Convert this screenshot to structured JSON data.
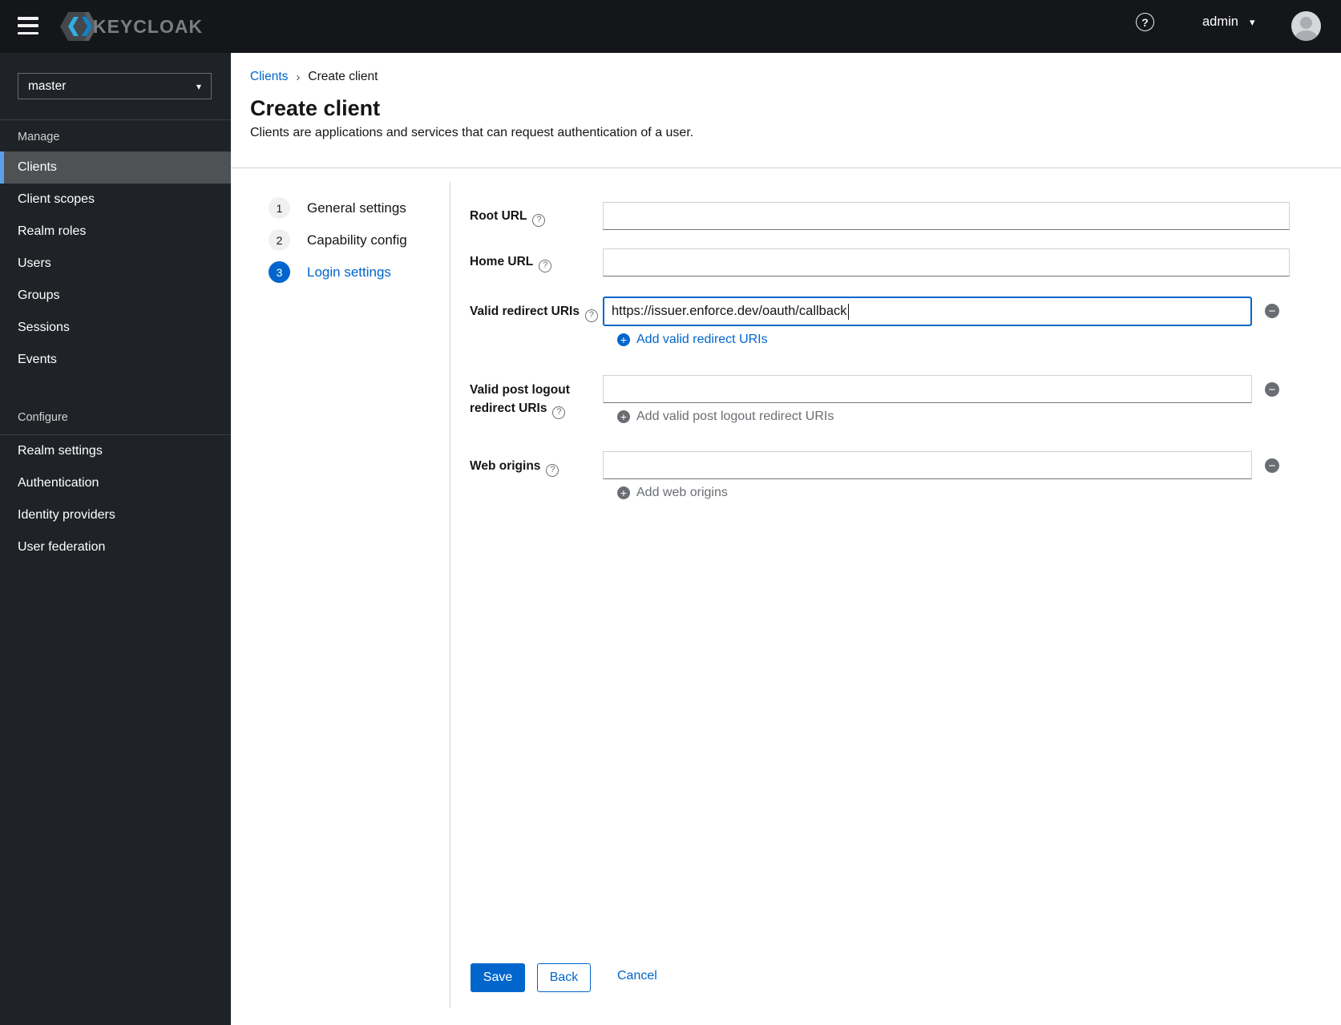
{
  "topbar": {
    "brand": "KEYCLOAK",
    "username": "admin"
  },
  "sidebar": {
    "realm_selector": {
      "value": "master"
    },
    "sections": [
      {
        "title": "Manage",
        "items": [
          "Clients",
          "Client scopes",
          "Realm roles",
          "Users",
          "Groups",
          "Sessions",
          "Events"
        ]
      },
      {
        "title": "Configure",
        "items": [
          "Realm settings",
          "Authentication",
          "Identity providers",
          "User federation"
        ]
      }
    ],
    "selected_item": "Clients"
  },
  "breadcrumb": {
    "link": "Clients",
    "current": "Create client"
  },
  "page": {
    "title": "Create client",
    "subtitle": "Clients are applications and services that can request authentication of a user."
  },
  "wizard": {
    "active_step": "3",
    "steps": [
      {
        "number": "1",
        "label": "General settings"
      },
      {
        "number": "2",
        "label": "Capability config"
      },
      {
        "number": "3",
        "label": "Login settings"
      }
    ]
  },
  "form": {
    "root_url": {
      "label": "Root URL",
      "value": "",
      "placeholder": ""
    },
    "home_url": {
      "label": "Home URL",
      "value": "",
      "placeholder": ""
    },
    "redirect_uris": {
      "label": "Valid redirect URIs",
      "value": "https://issuer.enforce.dev/oauth/callback",
      "add_label": "Add valid redirect URIs"
    },
    "post_logout": {
      "label": "Valid post logout redirect URIs",
      "value": "",
      "add_label": "Add valid post logout redirect URIs"
    },
    "web_origins": {
      "label": "Web origins",
      "value": "",
      "add_label": "Add web origins"
    }
  },
  "actions": {
    "save": "Save",
    "back": "Back",
    "cancel": "Cancel"
  },
  "icons": {
    "question": "?",
    "plus": "+",
    "minus": "−",
    "caret_down": "▾",
    "breadcrumb_sep": "›"
  },
  "colors": {
    "primary": "#0066cc",
    "masthead": "#141619",
    "sidebar": "#1f2226",
    "nav_current_bg": "#4f5255",
    "nav_indicator": "#5ba0e8",
    "muted": "#6a6e73"
  }
}
